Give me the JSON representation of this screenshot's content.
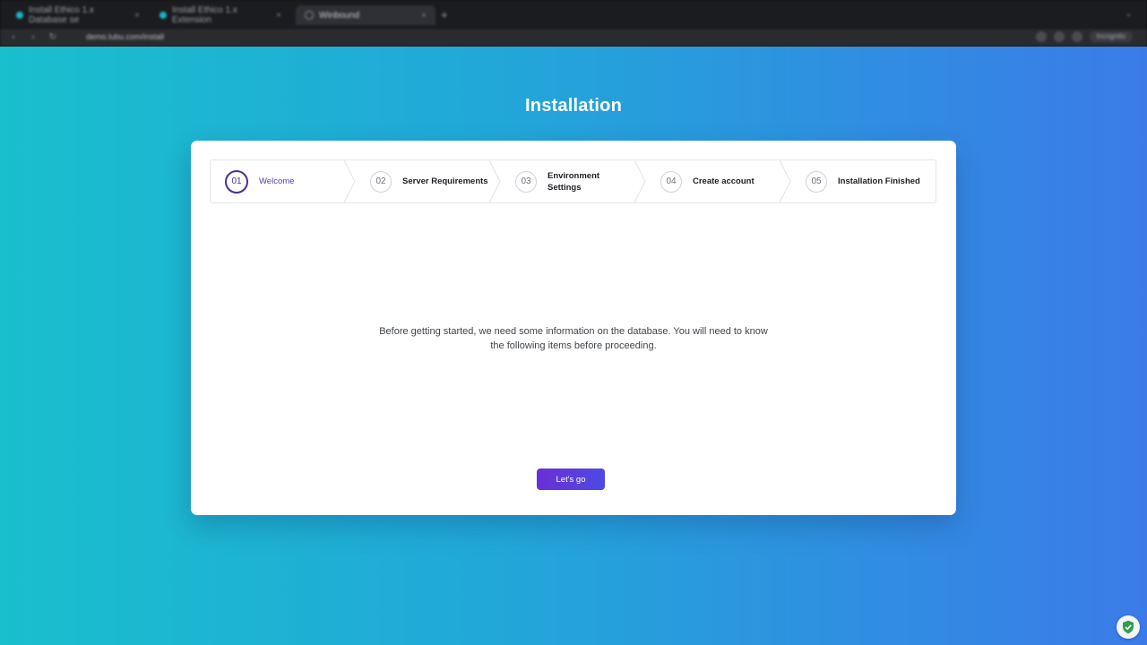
{
  "browser": {
    "tabs": [
      {
        "label": "Install Ethico 1.x Database se"
      },
      {
        "label": "Install Ethico 1.x Extension"
      },
      {
        "label": "Winbound"
      }
    ],
    "new_tab_label": "+",
    "url": "demo.lubu.com/install",
    "profile_label": "Incognito"
  },
  "page": {
    "title": "Installation",
    "steps": [
      {
        "num": "01",
        "label": "Welcome",
        "active": true
      },
      {
        "num": "02",
        "label": "Server Requirements",
        "active": false
      },
      {
        "num": "03",
        "label_line1": "Environment",
        "label_line2": "Settings",
        "active": false
      },
      {
        "num": "04",
        "label": "Create account",
        "active": false
      },
      {
        "num": "05",
        "label": "Installation Finished",
        "active": false
      }
    ],
    "intro_line1": "Before getting started, we need some information on the database. You will need to know",
    "intro_line2": "the following items before proceeding.",
    "primary_button": "Let's go"
  },
  "colors": {
    "gradient_start": "#19bfcd",
    "gradient_end": "#3b7be8",
    "active_step": "#4b2f93",
    "button_start": "#6a2fd6",
    "button_end": "#4e49e3"
  },
  "icons": {
    "extension_badge": "shield-check-icon"
  }
}
